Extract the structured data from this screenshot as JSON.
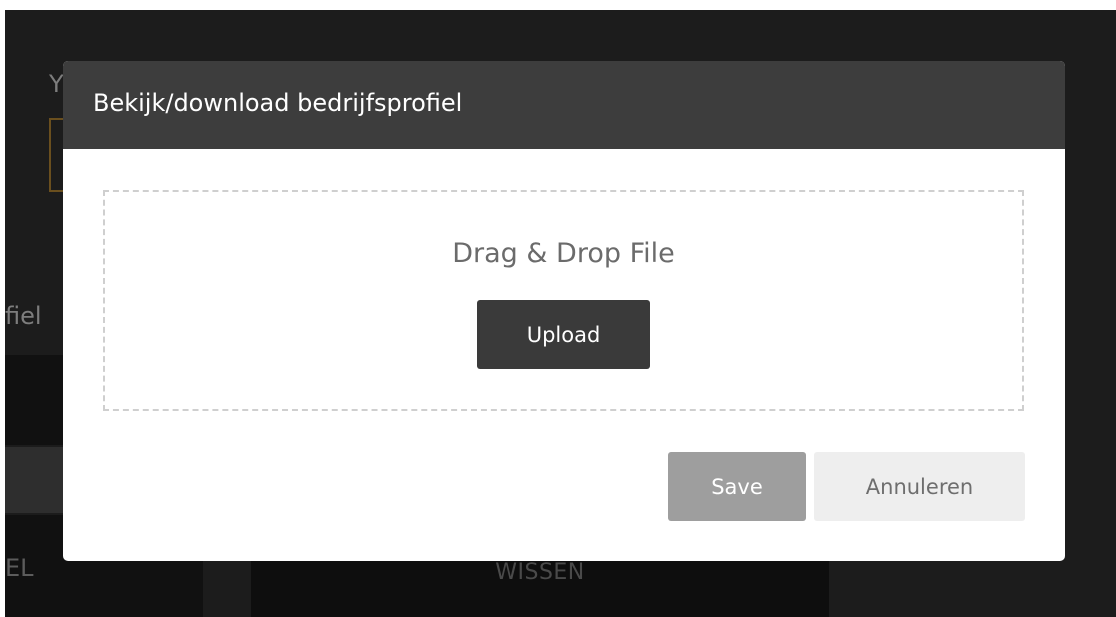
{
  "background": {
    "partial_heading_letter": "Y",
    "partial_label": "fiel",
    "partial_button_text": "EL",
    "wissen_button_label": "WISSEN"
  },
  "modal": {
    "title": "Bekijk/download bedrijfsprofiel",
    "dropzone": {
      "text": "Drag & Drop File",
      "upload_label": "Upload"
    },
    "footer": {
      "save_label": "Save",
      "cancel_label": "Annuleren"
    }
  },
  "colors": {
    "overlay": "#1c1c1c",
    "modal_header": "#3d3d3d",
    "upload_button": "#3a3a3a",
    "save_button": "#9e9e9e",
    "cancel_button": "#eeeeee"
  }
}
